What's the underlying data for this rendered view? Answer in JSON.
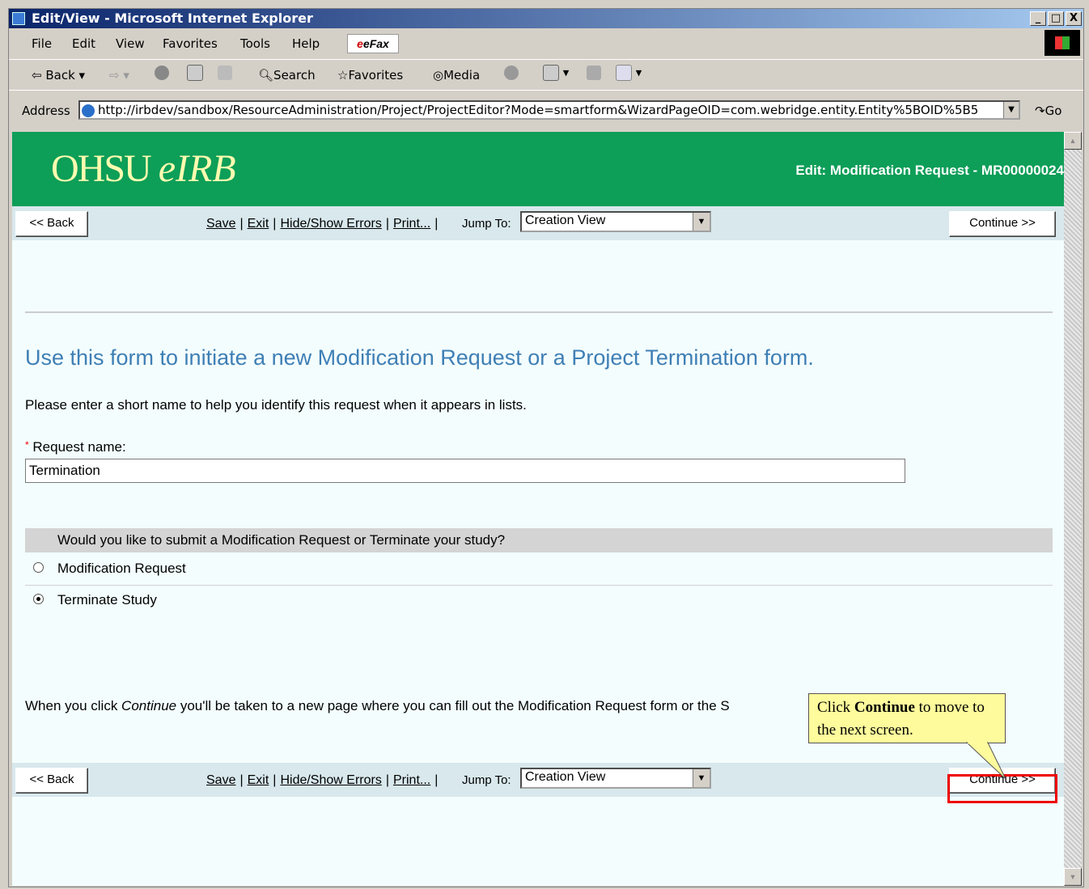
{
  "window": {
    "title": "Edit/View - Microsoft Internet Explorer",
    "controls": [
      "_",
      "□",
      "X"
    ]
  },
  "menu": [
    "File",
    "Edit",
    "View",
    "Favorites",
    "Tools",
    "Help"
  ],
  "efax_label": "eFax",
  "toolbar": {
    "back": "Back",
    "search": "Search",
    "favorites": "Favorites",
    "media": "Media"
  },
  "address": {
    "label": "Address",
    "url": "http://irbdev/sandbox/ResourceAdministration/Project/ProjectEditor?Mode=smartform&WizardPageOID=com.webridge.entity.Entity%5BOID%5B5",
    "go": "Go"
  },
  "header": {
    "logo_main": "OHSU",
    "logo_italic": "eIRB",
    "title": "Edit: Modification Request - MR00000024"
  },
  "nav": {
    "back": "<< Back",
    "continue": "Continue >>",
    "save": "Save",
    "exit": "Exit",
    "hide_show_errors": "Hide/Show Errors",
    "print": "Print...",
    "jump_to_label": "Jump To:",
    "jump_to_value": "Creation View"
  },
  "form": {
    "heading": "Use this form to initiate a new Modification Request or a Project Termination form.",
    "instruction": "Please enter a short name to help you identify this request when it appears in lists.",
    "request_name_label": "Request name:",
    "request_name_value": "Termination",
    "question": "Would you like to submit a Modification Request or Terminate your study?",
    "option1": "Modification Request",
    "option2": "Terminate Study",
    "selected": "Terminate Study",
    "footer_text": "When you click Continue you'll be taken to a new page where you can fill out the Modification Request form or the S"
  },
  "callout": {
    "pre": "Click",
    "bold": "Continue",
    "post": "to move to the next screen."
  },
  "colors": {
    "header_green": "#0d9e58",
    "logo_yellow": "#fdfbb0",
    "heading_blue": "#3f7fb5",
    "callout_yellow": "#fdfb9c",
    "highlight_red": "#ee0000"
  }
}
